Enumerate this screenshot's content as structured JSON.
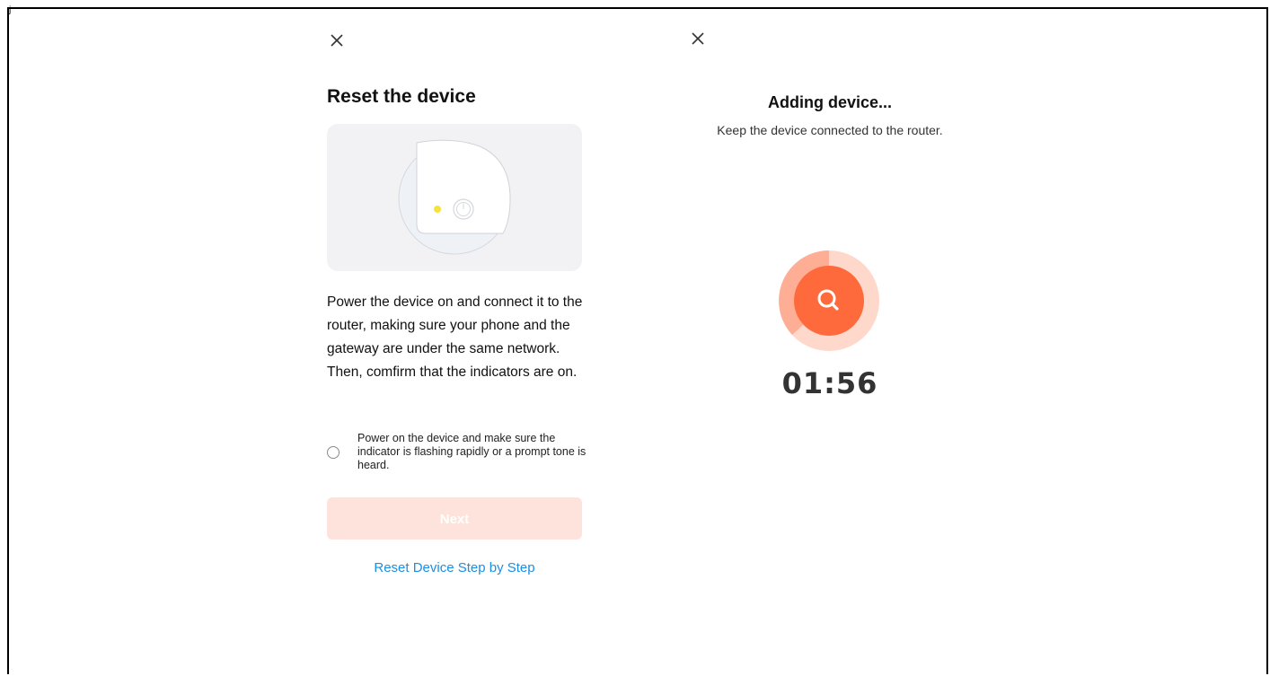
{
  "left_panel": {
    "title": "Reset the device",
    "description": "Power the device on and connect it to the router, making sure your phone and the gateway are under the same network. Then, comfirm that the indicators are on.",
    "confirm_checkbox_label": "Power on the device and make sure the indicator is flashing rapidly or a prompt tone is heard.",
    "confirm_checked": false,
    "next_label": "Next",
    "reset_link_label": "Reset Device Step by Step",
    "indicator_color": "#f5e23a"
  },
  "right_panel": {
    "title": "Adding device...",
    "subtitle": "Keep the device connected to the router.",
    "countdown": "01:56",
    "accent_color": "#ff6a3d"
  },
  "icons": {
    "close": "close-icon",
    "search": "search-icon",
    "power": "power-icon"
  }
}
